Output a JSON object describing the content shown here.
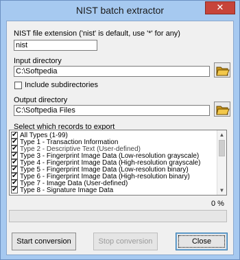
{
  "window": {
    "title": "NIST batch extractor",
    "close_glyph": "✕"
  },
  "nist": {
    "label": "NIST file extension ('nist' is default, use '*' for any)",
    "value": "nist"
  },
  "input": {
    "label": "Input directory",
    "value": "C:\\Softpedia",
    "button_icon": "open-folder-icon"
  },
  "subdirs": {
    "label": "Include subdirectories",
    "checked": false
  },
  "output": {
    "label": "Output directory",
    "value": "C:\\Softpedia Files",
    "button_icon": "open-folder-icon"
  },
  "records": {
    "label": "Select which records to export",
    "items": [
      "All Types (1-99)",
      "Type 1 - Transaction Information",
      "Type 2 - Descriptive Text (User-defined)",
      "Type 3 - Fingerprint Image Data (Low-resolution grayscale)",
      "Type 4 - Fingerprint Image Data (High-resolution grayscale)",
      "Type 5 - Fingerprint Image Data (Low-resolution binary)",
      "Type 6 - Fingerprint Image Data (High-resolution binary)",
      "Type 7 - Image Data (User-defined)",
      "Type 8 - Signature Image Data"
    ]
  },
  "progress": {
    "text": "0 %",
    "value": 0
  },
  "buttons": {
    "start": "Start conversion",
    "stop": "Stop conversion",
    "close": "Close"
  },
  "colors": {
    "titlebar": "#a6c9f0",
    "close_button": "#c7443a",
    "progress_fill": "#06b025",
    "folder": "#e8b93b"
  }
}
